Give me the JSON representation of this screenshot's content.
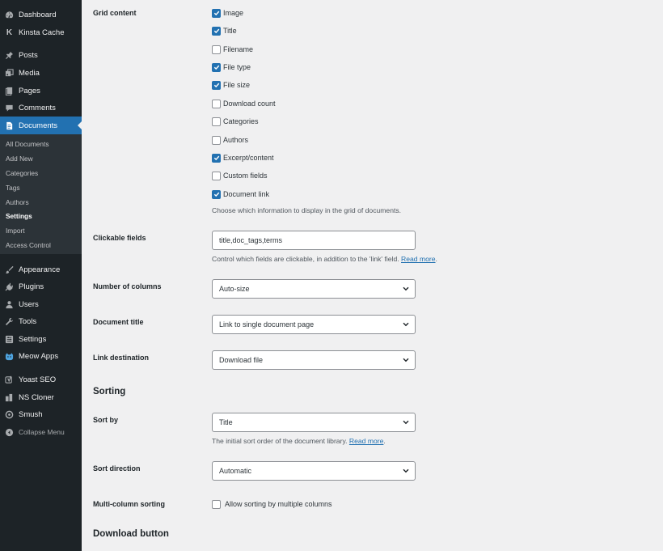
{
  "sidebar": {
    "menu_top": [
      {
        "label": "Dashboard",
        "icon": "dashboard-icon"
      },
      {
        "label": "Kinsta Cache",
        "icon": "kinsta-k-icon"
      }
    ],
    "menu_content": [
      {
        "label": "Posts",
        "icon": "pin-icon"
      },
      {
        "label": "Media",
        "icon": "media-icon"
      },
      {
        "label": "Pages",
        "icon": "pages-icon"
      },
      {
        "label": "Comments",
        "icon": "comment-icon"
      },
      {
        "label": "Documents",
        "icon": "document-icon"
      }
    ],
    "documents_submenu": [
      "All Documents",
      "Add New",
      "Categories",
      "Tags",
      "Authors",
      "Settings",
      "Import",
      "Access Control"
    ],
    "menu_admin": [
      {
        "label": "Appearance",
        "icon": "brush-icon"
      },
      {
        "label": "Plugins",
        "icon": "plugin-icon"
      },
      {
        "label": "Users",
        "icon": "user-icon"
      },
      {
        "label": "Tools",
        "icon": "wrench-icon"
      },
      {
        "label": "Settings",
        "icon": "settings-icon"
      },
      {
        "label": "Meow Apps",
        "icon": "meow-icon"
      }
    ],
    "menu_plugins": [
      {
        "label": "Yoast SEO",
        "icon": "yoast-icon"
      },
      {
        "label": "NS Cloner",
        "icon": "cloner-icon"
      },
      {
        "label": "Smush",
        "icon": "smush-icon"
      }
    ],
    "collapse_label": "Collapse Menu"
  },
  "form": {
    "grid_content": {
      "label": "Grid content",
      "options": [
        {
          "label": "Image",
          "checked": true
        },
        {
          "label": "Title",
          "checked": true
        },
        {
          "label": "Filename",
          "checked": false
        },
        {
          "label": "File type",
          "checked": true
        },
        {
          "label": "File size",
          "checked": true
        },
        {
          "label": "Download count",
          "checked": false
        },
        {
          "label": "Categories",
          "checked": false
        },
        {
          "label": "Authors",
          "checked": false
        },
        {
          "label": "Excerpt/content",
          "checked": true
        },
        {
          "label": "Custom fields",
          "checked": false
        },
        {
          "label": "Document link",
          "checked": true
        }
      ],
      "description": "Choose which information to display in the grid of documents."
    },
    "clickable_fields": {
      "label": "Clickable fields",
      "value": "title,doc_tags,terms",
      "description": "Control which fields are clickable, in addition to the 'link' field.",
      "link_text": "Read more"
    },
    "number_of_columns": {
      "label": "Number of columns",
      "value": "Auto-size"
    },
    "document_title": {
      "label": "Document title",
      "value": "Link to single document page"
    },
    "link_destination": {
      "label": "Link destination",
      "value": "Download file"
    },
    "sorting_heading": "Sorting",
    "sort_by": {
      "label": "Sort by",
      "value": "Title",
      "description": "The initial sort order of the document library.",
      "link_text": "Read more"
    },
    "sort_direction": {
      "label": "Sort direction",
      "value": "Automatic"
    },
    "multi_column_sorting": {
      "label": "Multi-column sorting",
      "checkbox_label": "Allow sorting by multiple columns",
      "checked": false
    },
    "download_button_heading": "Download button"
  },
  "colors": {
    "sidebar_bg": "#1d2327",
    "submenu_bg": "#2c3338",
    "accent": "#2271b1",
    "page_bg": "#f0f0f1"
  }
}
